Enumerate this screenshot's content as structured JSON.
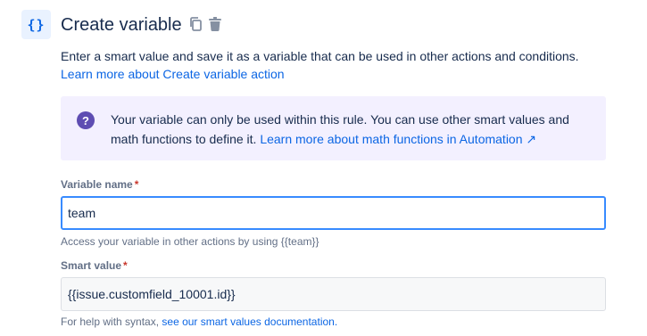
{
  "header": {
    "icon_glyph": "{}",
    "title": "Create variable",
    "copy_icon": "copy-icon",
    "delete_icon": "trash-icon"
  },
  "description": {
    "text": "Enter a smart value and save it as a variable that can be used in other actions and conditions.",
    "link": "Learn more about Create variable action"
  },
  "info_panel": {
    "icon": "question-circle-icon",
    "text": "Your variable can only be used within this rule. You can use other smart values and math functions to define it.",
    "link": "Learn more about math functions in Automation ↗"
  },
  "variable_name": {
    "label": "Variable name",
    "required_mark": "*",
    "value": "team",
    "helper": "Access your variable in other actions by using {{team}}"
  },
  "smart_value": {
    "label": "Smart value",
    "required_mark": "*",
    "value": "{{issue.customfield_10001.id}}",
    "helper_text": "For help with syntax,",
    "helper_link": "see our smart values documentation."
  },
  "colors": {
    "accent": "#0c66e4",
    "info_bg": "#f3f0ff",
    "info_icon": "#5e4db2",
    "required": "#c9372c"
  }
}
